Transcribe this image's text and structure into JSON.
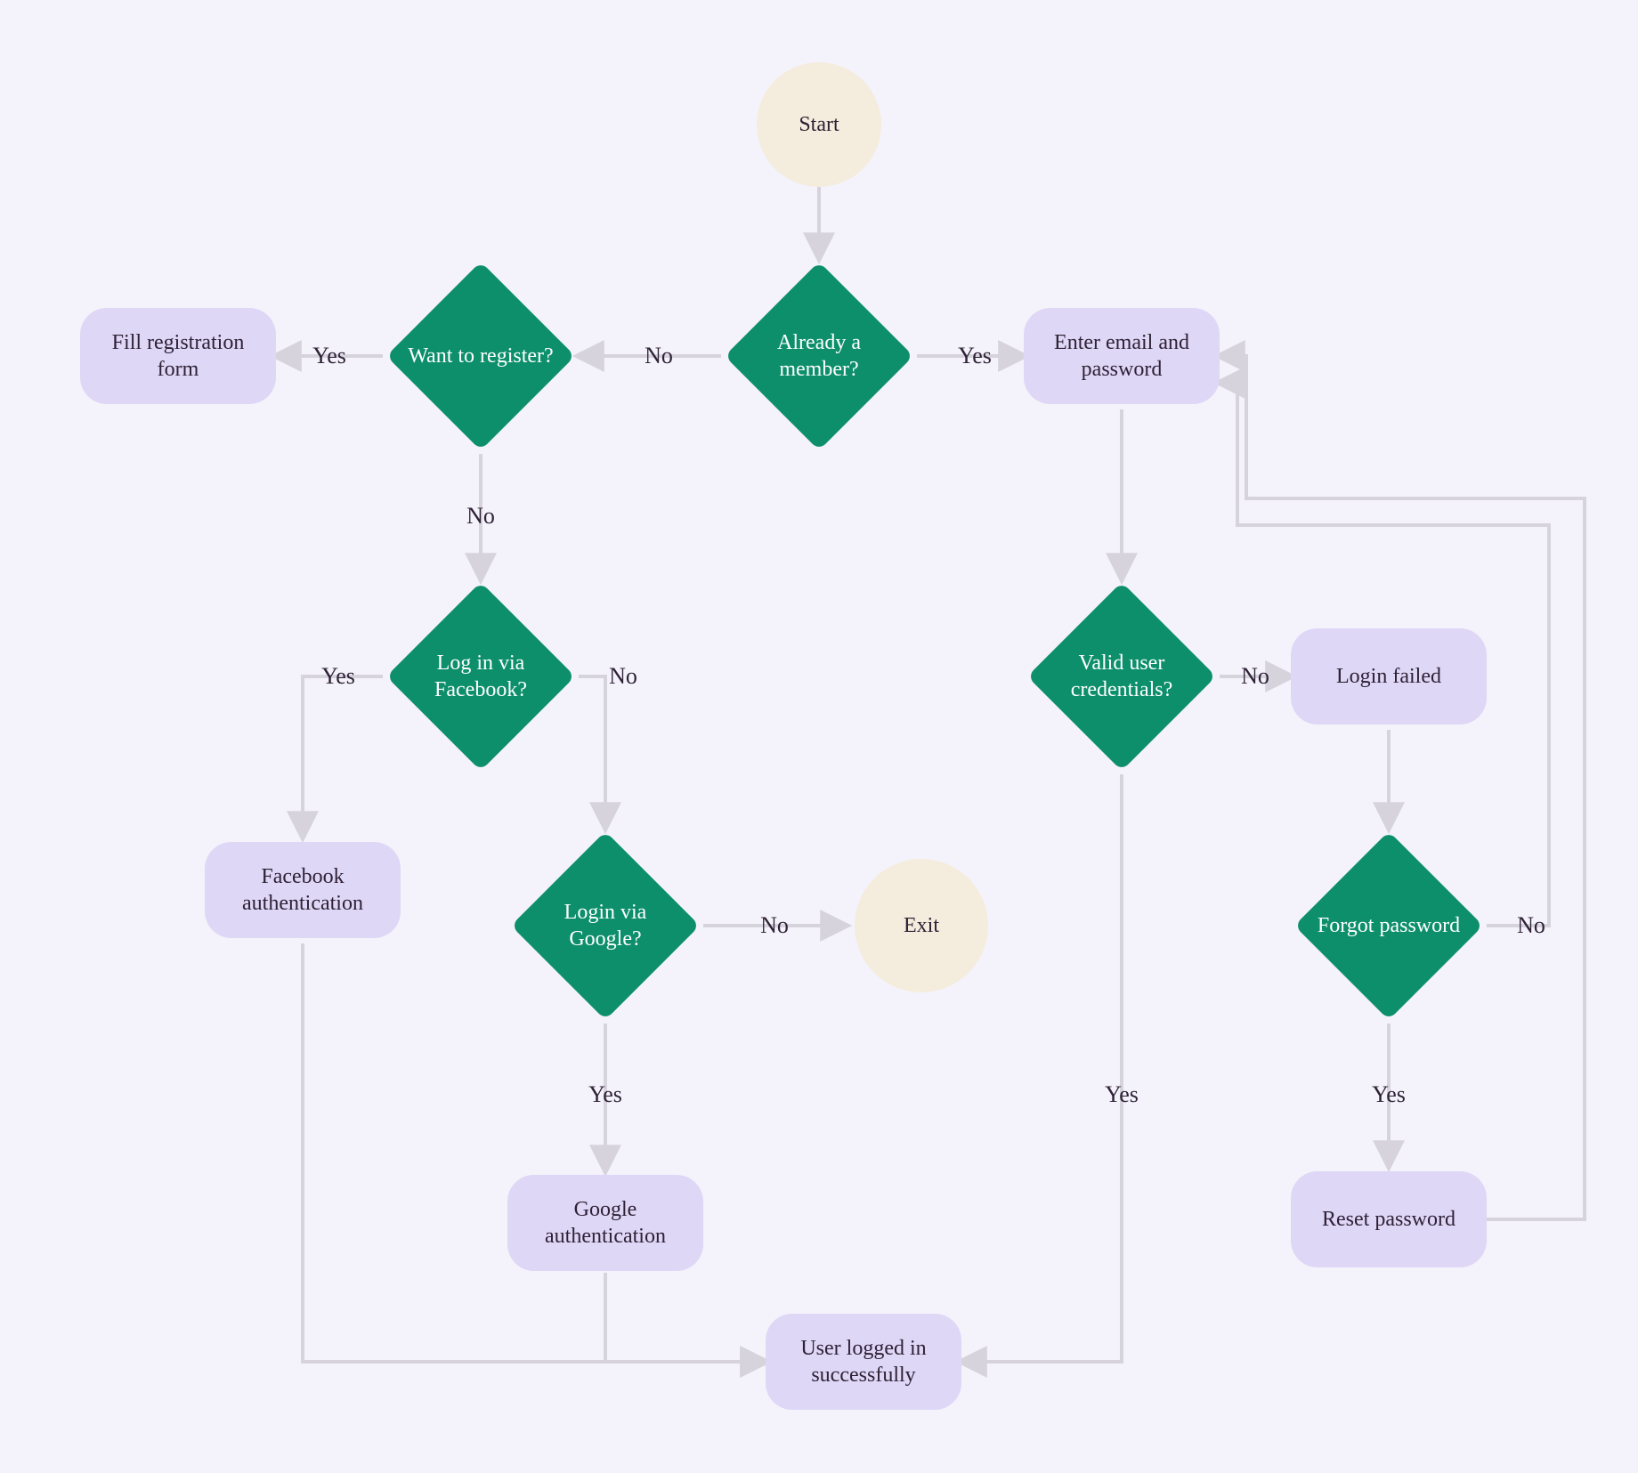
{
  "nodes": {
    "start": "Start",
    "exit": "Exit",
    "already_member": "Already a member?",
    "want_register": "Want to register?",
    "login_facebook": "Log in via Facebook?",
    "login_google": "Login via Google?",
    "valid_creds": "Valid user credentials?",
    "forgot_pw": "Forgot password",
    "fill_registration": "Fill registration form",
    "enter_email_pw": "Enter email and password",
    "login_failed": "Login failed",
    "facebook_auth": "Facebook authentication",
    "google_auth": "Google authentication",
    "logged_in": "User logged in successfully",
    "reset_pw": "Reset password"
  },
  "labels": {
    "yes": "Yes",
    "no": "No"
  },
  "chart_data": {
    "type": "flowchart",
    "nodes": [
      {
        "id": "start",
        "type": "terminal",
        "label": "Start"
      },
      {
        "id": "already_member",
        "type": "decision",
        "label": "Already a member?"
      },
      {
        "id": "want_register",
        "type": "decision",
        "label": "Want to register?"
      },
      {
        "id": "fill_registration",
        "type": "process",
        "label": "Fill registration form"
      },
      {
        "id": "login_facebook",
        "type": "decision",
        "label": "Log in via Facebook?"
      },
      {
        "id": "facebook_auth",
        "type": "process",
        "label": "Facebook authentication"
      },
      {
        "id": "login_google",
        "type": "decision",
        "label": "Login via Google?"
      },
      {
        "id": "exit",
        "type": "terminal",
        "label": "Exit"
      },
      {
        "id": "google_auth",
        "type": "process",
        "label": "Google authentication"
      },
      {
        "id": "enter_email_pw",
        "type": "process",
        "label": "Enter email and password"
      },
      {
        "id": "valid_creds",
        "type": "decision",
        "label": "Valid user credentials?"
      },
      {
        "id": "login_failed",
        "type": "process",
        "label": "Login failed"
      },
      {
        "id": "forgot_pw",
        "type": "decision",
        "label": "Forgot password"
      },
      {
        "id": "reset_pw",
        "type": "process",
        "label": "Reset password"
      },
      {
        "id": "logged_in",
        "type": "process",
        "label": "User logged in successfully"
      }
    ],
    "edges": [
      {
        "from": "start",
        "to": "already_member",
        "label": ""
      },
      {
        "from": "already_member",
        "to": "enter_email_pw",
        "label": "Yes"
      },
      {
        "from": "already_member",
        "to": "want_register",
        "label": "No"
      },
      {
        "from": "want_register",
        "to": "fill_registration",
        "label": "Yes"
      },
      {
        "from": "want_register",
        "to": "login_facebook",
        "label": "No"
      },
      {
        "from": "login_facebook",
        "to": "facebook_auth",
        "label": "Yes"
      },
      {
        "from": "login_facebook",
        "to": "login_google",
        "label": "No"
      },
      {
        "from": "login_google",
        "to": "exit",
        "label": "No"
      },
      {
        "from": "login_google",
        "to": "google_auth",
        "label": "Yes"
      },
      {
        "from": "google_auth",
        "to": "logged_in",
        "label": ""
      },
      {
        "from": "facebook_auth",
        "to": "logged_in",
        "label": ""
      },
      {
        "from": "enter_email_pw",
        "to": "valid_creds",
        "label": ""
      },
      {
        "from": "valid_creds",
        "to": "logged_in",
        "label": "Yes"
      },
      {
        "from": "valid_creds",
        "to": "login_failed",
        "label": "No"
      },
      {
        "from": "login_failed",
        "to": "forgot_pw",
        "label": ""
      },
      {
        "from": "forgot_pw",
        "to": "reset_pw",
        "label": "Yes"
      },
      {
        "from": "forgot_pw",
        "to": "enter_email_pw",
        "label": "No"
      },
      {
        "from": "reset_pw",
        "to": "enter_email_pw",
        "label": ""
      }
    ]
  }
}
